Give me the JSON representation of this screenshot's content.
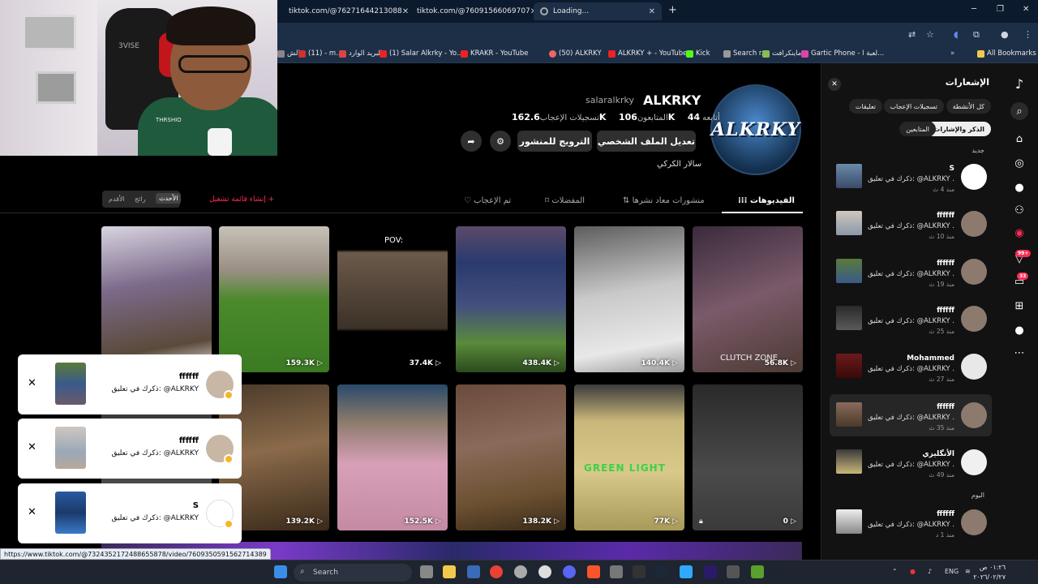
{
  "browser": {
    "tabs": [
      {
        "title": "tiktok.com/@76271644213088"
      },
      {
        "title": "tiktok.com/@76091566069707"
      },
      {
        "title": "Loading..."
      }
    ],
    "new_tab": "+",
    "window_controls": {
      "minimize": "─",
      "restore": "❐",
      "close": "✕"
    },
    "bookmarks": [
      {
        "label": "الش",
        "color": "#888"
      },
      {
        "label": "(11) - m...",
        "color": "#c33"
      },
      {
        "label": "البريد الوارد",
        "color": "#d44"
      },
      {
        "label": "(1) Salar Alkrky - Yo...",
        "color": "#e22"
      },
      {
        "label": "KRAKR - YouTube",
        "color": "#e22"
      },
      {
        "label": "(50) ALKRKY",
        "color": "#e66"
      },
      {
        "label": "ALKRKY + - YouTube",
        "color": "#e22"
      },
      {
        "label": "Kick",
        "color": "#53fc18"
      },
      {
        "label": "Search r...",
        "color": "#999"
      },
      {
        "label": "ماينكرافت",
        "color": "#8b5"
      },
      {
        "label": "Gartic Phone - لعبة ا...",
        "color": "#d4a"
      }
    ],
    "all_bookmarks": "All Bookmarks",
    "status_url": "https://www.tiktok.com/@7324352172488655878/video/7609350591562714389"
  },
  "profile": {
    "display_name": "ALKRKY",
    "handle": "salaralkrky",
    "real_name": "سالار الكركي",
    "following_count": "44",
    "following_label": "أتابعه",
    "followers_count": "106K",
    "followers_label": "المتابعون",
    "likes_count": "162.6K",
    "likes_label": "تسجيلات الإعجاب",
    "edit_profile": "تعديل الملف الشخصي",
    "promote_post": "الترويج للمنشور",
    "avatar_text": "ALKRKY"
  },
  "profile_tabs": {
    "videos": "الفيديوهات",
    "reposts": "منشورات معاد نشرها",
    "favorites": "المفضلات",
    "liked": "تم الإعجاب"
  },
  "sort": {
    "latest": "الأحدث",
    "popular": "رائج",
    "oldest": "الأقدم"
  },
  "create_playlist": "إنشاء قائمة تشغيل +",
  "videos": [
    {
      "views": "56.8K",
      "overlay": "CLUTCH ZONE",
      "locked": false
    },
    {
      "views": "140.4K",
      "overlay": "",
      "locked": false
    },
    {
      "views": "438.4K",
      "overlay": "",
      "locked": false
    },
    {
      "views": "37.4K",
      "overlay": "POV:",
      "locked": false
    },
    {
      "views": "159.3K",
      "overlay": "",
      "locked": false
    },
    {
      "views": "",
      "overlay": "",
      "locked": false
    },
    {
      "views": "0",
      "overlay": "",
      "locked": true
    },
    {
      "views": "77K",
      "overlay": "GREEN LIGHT",
      "locked": false
    },
    {
      "views": "138.2K",
      "overlay": "",
      "locked": false
    },
    {
      "views": "152.5K",
      "overlay": "",
      "locked": false
    },
    {
      "views": "139.2K",
      "overlay": "",
      "locked": false
    },
    {
      "views": "",
      "overlay": "",
      "locked": false
    }
  ],
  "toasts": [
    {
      "name": "ffffff",
      "message": "ذكرك في تعليق: @ALKRKY"
    },
    {
      "name": "ffffff",
      "message": "ذكرك في تعليق: @ALKRKY"
    },
    {
      "name": "S",
      "message": "ذكرك في تعليق: @ALKRKY"
    }
  ],
  "notifications": {
    "title": "الإشعارات",
    "filters": {
      "all": "كل الأنشطة",
      "likes": "تسجيلات الإعجاب",
      "comments": "تعليقات",
      "mentions": "الذكر والإشارات",
      "followers": "المتابعين"
    },
    "section_new": "جديد",
    "section_today": "اليوم",
    "items": [
      {
        "name": "S",
        "text": "ذكرك في تعليق: @ALKRKY .",
        "time": "منذ 4 ث"
      },
      {
        "name": "ffffff",
        "text": "ذكرك في تعليق: @ALKRKY .",
        "time": "منذ 10 ث"
      },
      {
        "name": "ffffff",
        "text": "ذكرك في تعليق: @ALKRKY .",
        "time": "منذ 19 ث"
      },
      {
        "name": "ffffff",
        "text": "ذكرك في تعليق: @ALKRKY .",
        "time": "منذ 25 ث"
      },
      {
        "name": "Mohammed",
        "text": "ذكرك في تعليق: @ALKRKY .",
        "time": "منذ 27 ث"
      },
      {
        "name": "ffffff",
        "text": "ذكرك في تعليق: @ALKRKY .",
        "time": "منذ 35 ث"
      },
      {
        "name": "الأنگليزي",
        "text": "ذكرك في تعليق: @ALKRKY .",
        "time": "منذ 49 ث"
      },
      {
        "name": "ffffff",
        "text": "ذكرك في تعليق: @ALKRKY .",
        "time": "منذ 1 د"
      }
    ]
  },
  "rail_badges": {
    "inbox": "99+",
    "messages": "33"
  },
  "taskbar": {
    "search": "Search",
    "lang": "ENG",
    "time": "٠١:٢٦ ص",
    "date": "٢٠٢٦/٠٢/٢٧"
  },
  "webcam": {
    "brand": "3VISE",
    "shirt_text": "THRSHIO"
  },
  "colors": {
    "accent": "#fe2c55",
    "panel": "#121212",
    "page": "#000000"
  }
}
